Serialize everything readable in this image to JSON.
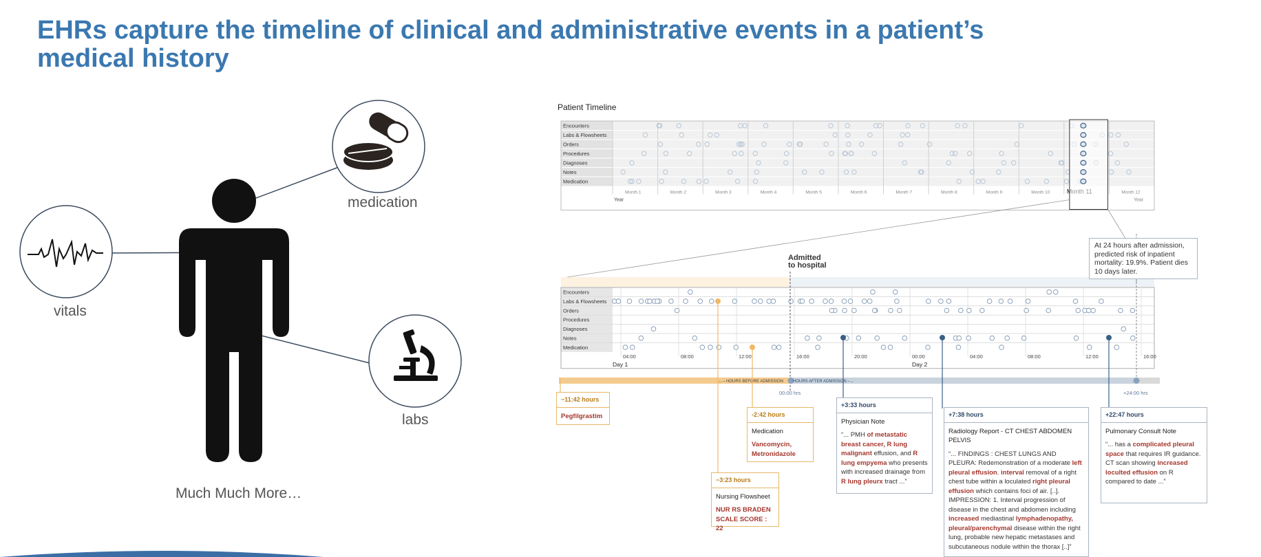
{
  "slide": {
    "title": "EHRs capture the timeline of clinical and administrative events in a patient’s medical history"
  },
  "figure": {
    "captions": {
      "medication": "medication",
      "vitals": "vitals",
      "labs": "labs",
      "more": "Much Much More…"
    },
    "icons": [
      "person-silhouette-icon",
      "pills-icon",
      "heartbeat-icon",
      "microscope-icon"
    ]
  },
  "timeline": {
    "title": "Patient Timeline",
    "rows": [
      "Encounters",
      "Labs & Flowsheets",
      "Orders",
      "Procedures",
      "Diagnoses",
      "Notes",
      "Medication"
    ],
    "overview": {
      "months": [
        "Month 1",
        "Month 2",
        "Month 3",
        "Month 4",
        "Month 5",
        "Month 6",
        "Month 7",
        "Month 8",
        "Month 9",
        "Month 10",
        "Month 11",
        "Month 12"
      ],
      "highlight_month": "Month 11",
      "year_left": "Year",
      "year_right": "Year"
    },
    "detail": {
      "times": [
        "04:00",
        "08:00",
        "12:00",
        "16:00",
        "20:00",
        "00:00",
        "04:00",
        "08:00",
        "12:00",
        "16:00"
      ],
      "day1": "Day 1",
      "day2": "Day 2",
      "admitted_line1": "Admitted",
      "admitted_line2": "to hospital",
      "hours_before": "HOURS BEFORE ADMISSION",
      "hours_after": "HOURS AFTER ADMISSION",
      "zero_label": "00:00 hrs",
      "plus24_label": "+24:00 hrs"
    },
    "prediction": "At 24 hours after admission, predicted risk of inpatient mortality: 19.9%. Patient dies 10 days later.",
    "colors": {
      "before": "#f0b968",
      "after": "#3c5f86",
      "accent_text": "#a4372e"
    }
  },
  "callouts": {
    "pegfilgrastim": {
      "time": "−11:42 hours",
      "drug": "Pegfilgrastim"
    },
    "medication": {
      "time": "-2:42 hours",
      "head": "Medication",
      "drugs": "Vancomycin, Metronidazole"
    },
    "nursing": {
      "time": "−3:23 hours",
      "head": "Nursing Flowsheet",
      "value": "NUR RS BRADEN SCALE SCORE : 22"
    },
    "physician": {
      "time": "+3:33 hours",
      "head": "Physician Note",
      "t1": "“... PMH ",
      "h1": "of metastatic breast cancer, R lung malignant",
      "t2": " effusion, and ",
      "h2": "R lung empyema",
      "t3": " who presents with increased drainage from ",
      "h3": "R lung pleurx",
      "t4": " tract ...”"
    },
    "radiology": {
      "time": "+7:38 hours",
      "head": "Radiology Report - CT CHEST ABDOMEN PELVIS",
      "t1": "“... FINDINGS : CHEST LUNGS AND PLEURA: Redemonstration of a moderate ",
      "h1": "left pleural effusion",
      "t2": ". ",
      "h2": "interval",
      "t3": " removal of a right chest tube within a loculated ",
      "h3": "right pleural effusion",
      "t4": " which contains foci of air. [..]. IMPRESSION: 1. Interval progression of disease in the chest and abdomen including ",
      "h4": "increased",
      "t5": " mediastinal ",
      "h5": "lymphadenopathy, pleural/parenchymal",
      "t6": " disease within the right lung, probable new hepatic metastases and subcutaneous nodule within the thorax [..]”"
    },
    "pulmonary": {
      "time": "+22:47 hours",
      "head": "Pulmonary Consult Note",
      "t1": "“... has a ",
      "h1": "complicated pleural space",
      "t2": " that requires IR guidance. CT scan showing ",
      "h2": "increased loculted effusion",
      "t3": " on R compared to date ...”"
    }
  }
}
